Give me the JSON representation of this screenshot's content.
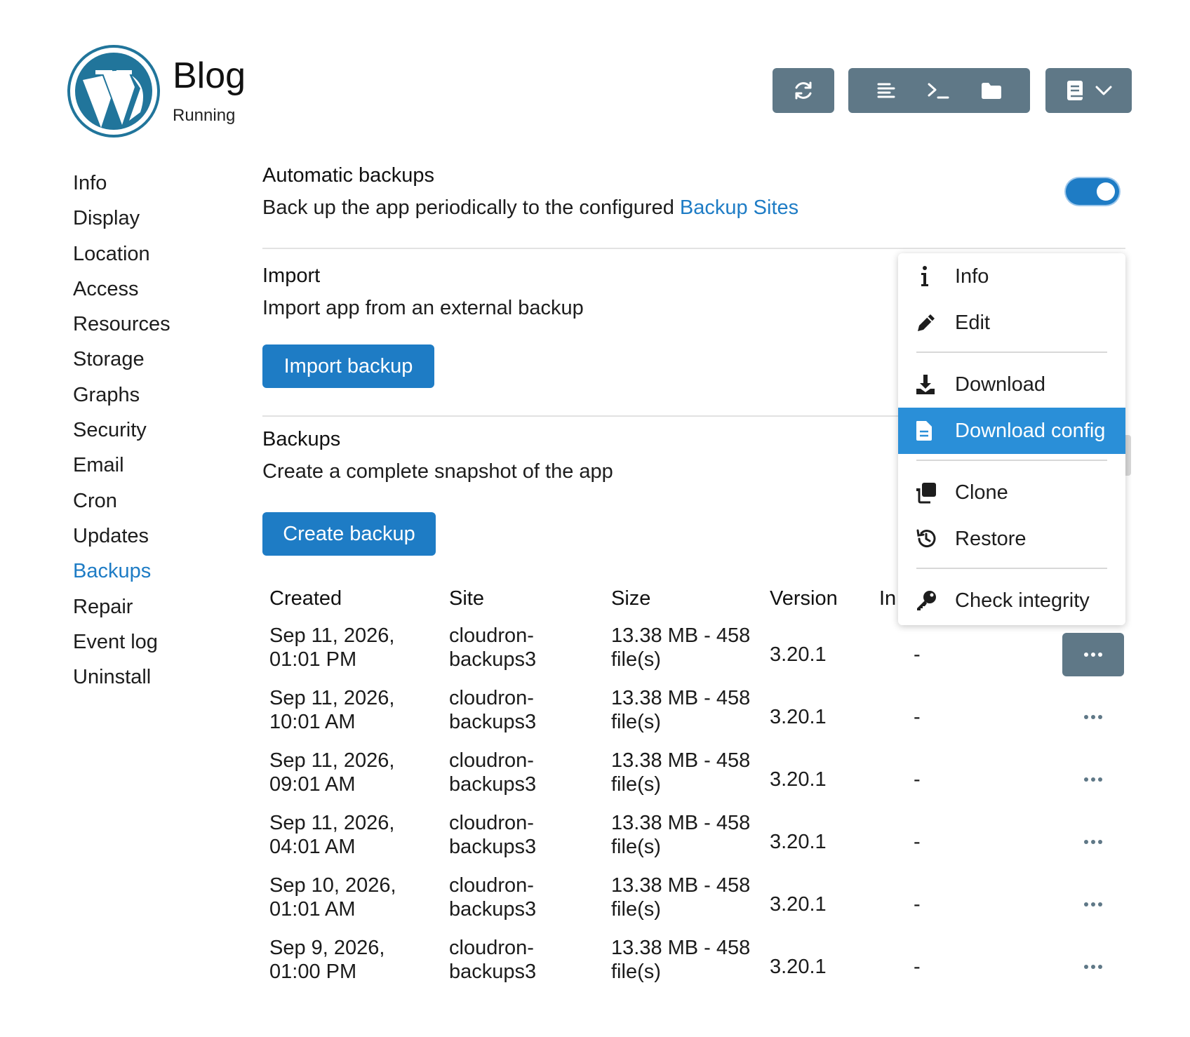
{
  "header": {
    "title": "Blog",
    "status": "Running",
    "logo": "wordpress-logo",
    "toolbar_icons": [
      "refresh-icon",
      "logs-icon",
      "terminal-icon",
      "folder-icon",
      "book-icon",
      "chevron-down-icon"
    ]
  },
  "sidebar": {
    "items": [
      {
        "label": "Info"
      },
      {
        "label": "Display"
      },
      {
        "label": "Location"
      },
      {
        "label": "Access"
      },
      {
        "label": "Resources"
      },
      {
        "label": "Storage"
      },
      {
        "label": "Graphs"
      },
      {
        "label": "Security"
      },
      {
        "label": "Email"
      },
      {
        "label": "Cron"
      },
      {
        "label": "Updates"
      },
      {
        "label": "Backups",
        "active": true
      },
      {
        "label": "Repair"
      },
      {
        "label": "Event log"
      },
      {
        "label": "Uninstall"
      }
    ]
  },
  "auto_backups": {
    "title": "Automatic backups",
    "desc_prefix": "Back up the app periodically to the configured",
    "link": "Backup Sites",
    "enabled": true
  },
  "import": {
    "title": "Import",
    "desc": "Import app from an external backup",
    "button": "Import backup"
  },
  "backups": {
    "title": "Backups",
    "desc": "Create a complete snapshot of the app",
    "button": "Create backup",
    "columns": [
      "Created",
      "Site",
      "Size",
      "Version",
      "In"
    ],
    "rows": [
      {
        "date": "Sep 11, 2026,",
        "time": "01:01 PM",
        "site1": "cloudron-",
        "site2": "backups3",
        "size1": "13.38 MB - 458",
        "size2": "file(s)",
        "version": "3.20.1",
        "integrity": "-"
      },
      {
        "date": "Sep 11, 2026,",
        "time": "10:01 AM",
        "site1": "cloudron-",
        "site2": "backups3",
        "size1": "13.38 MB - 458",
        "size2": "file(s)",
        "version": "3.20.1",
        "integrity": "-"
      },
      {
        "date": "Sep 11, 2026,",
        "time": "09:01 AM",
        "site1": "cloudron-",
        "site2": "backups3",
        "size1": "13.38 MB - 458",
        "size2": "file(s)",
        "version": "3.20.1",
        "integrity": "-"
      },
      {
        "date": "Sep 11, 2026,",
        "time": "04:01 AM",
        "site1": "cloudron-",
        "site2": "backups3",
        "size1": "13.38 MB - 458",
        "size2": "file(s)",
        "version": "3.20.1",
        "integrity": "-"
      },
      {
        "date": "Sep 10, 2026,",
        "time": "01:01 AM",
        "site1": "cloudron-",
        "site2": "backups3",
        "size1": "13.38 MB - 458",
        "size2": "file(s)",
        "version": "3.20.1",
        "integrity": "-"
      },
      {
        "date": "Sep 9, 2026,",
        "time": "01:00 PM",
        "site1": "cloudron-",
        "site2": "backups3",
        "size1": "13.38 MB - 458",
        "size2": "file(s)",
        "version": "3.20.1",
        "integrity": "-"
      }
    ]
  },
  "row_menu": {
    "items": [
      {
        "label": "Info",
        "icon": "info-icon"
      },
      {
        "label": "Edit",
        "icon": "pencil-icon"
      },
      {
        "label": "Download",
        "icon": "download-icon"
      },
      {
        "label": "Download config",
        "icon": "file-icon",
        "active": true
      },
      {
        "label": "Clone",
        "icon": "clone-icon"
      },
      {
        "label": "Restore",
        "icon": "history-icon"
      },
      {
        "label": "Check integrity",
        "icon": "key-icon"
      }
    ]
  }
}
